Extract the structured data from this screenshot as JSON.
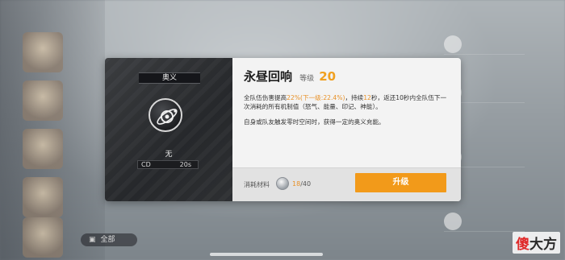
{
  "dialog": {
    "category_tag": "奥义",
    "skill_icon": "planet-orbit-icon",
    "slot_label": "无",
    "cd": {
      "label": "CD",
      "value": "20s"
    },
    "title": "永昼回响",
    "level_label": "等级",
    "level_value": "20",
    "desc": {
      "p1_a": "全队伍伤害提高",
      "p1_hl1": "22%(下一级:22.4%)",
      "p1_b": "，持续",
      "p1_hl2": "12",
      "p1_c": "秒，返还10秒内全队伍下一次消耗的所有机制值（怒气、能量、印记、神能）。",
      "p2": "自身或队友触发零时空间时，获得一定的奥义充能。"
    },
    "footer": {
      "material_label": "消耗材料",
      "material_icon": "material-gear-icon",
      "material_have": "18",
      "material_need": "/40",
      "upgrade_label": "升级"
    },
    "accent_color": "#f29a1a"
  },
  "background": {
    "filter_pill_label": "全部"
  },
  "watermark": {
    "red": "傻",
    "rest": "大方"
  }
}
